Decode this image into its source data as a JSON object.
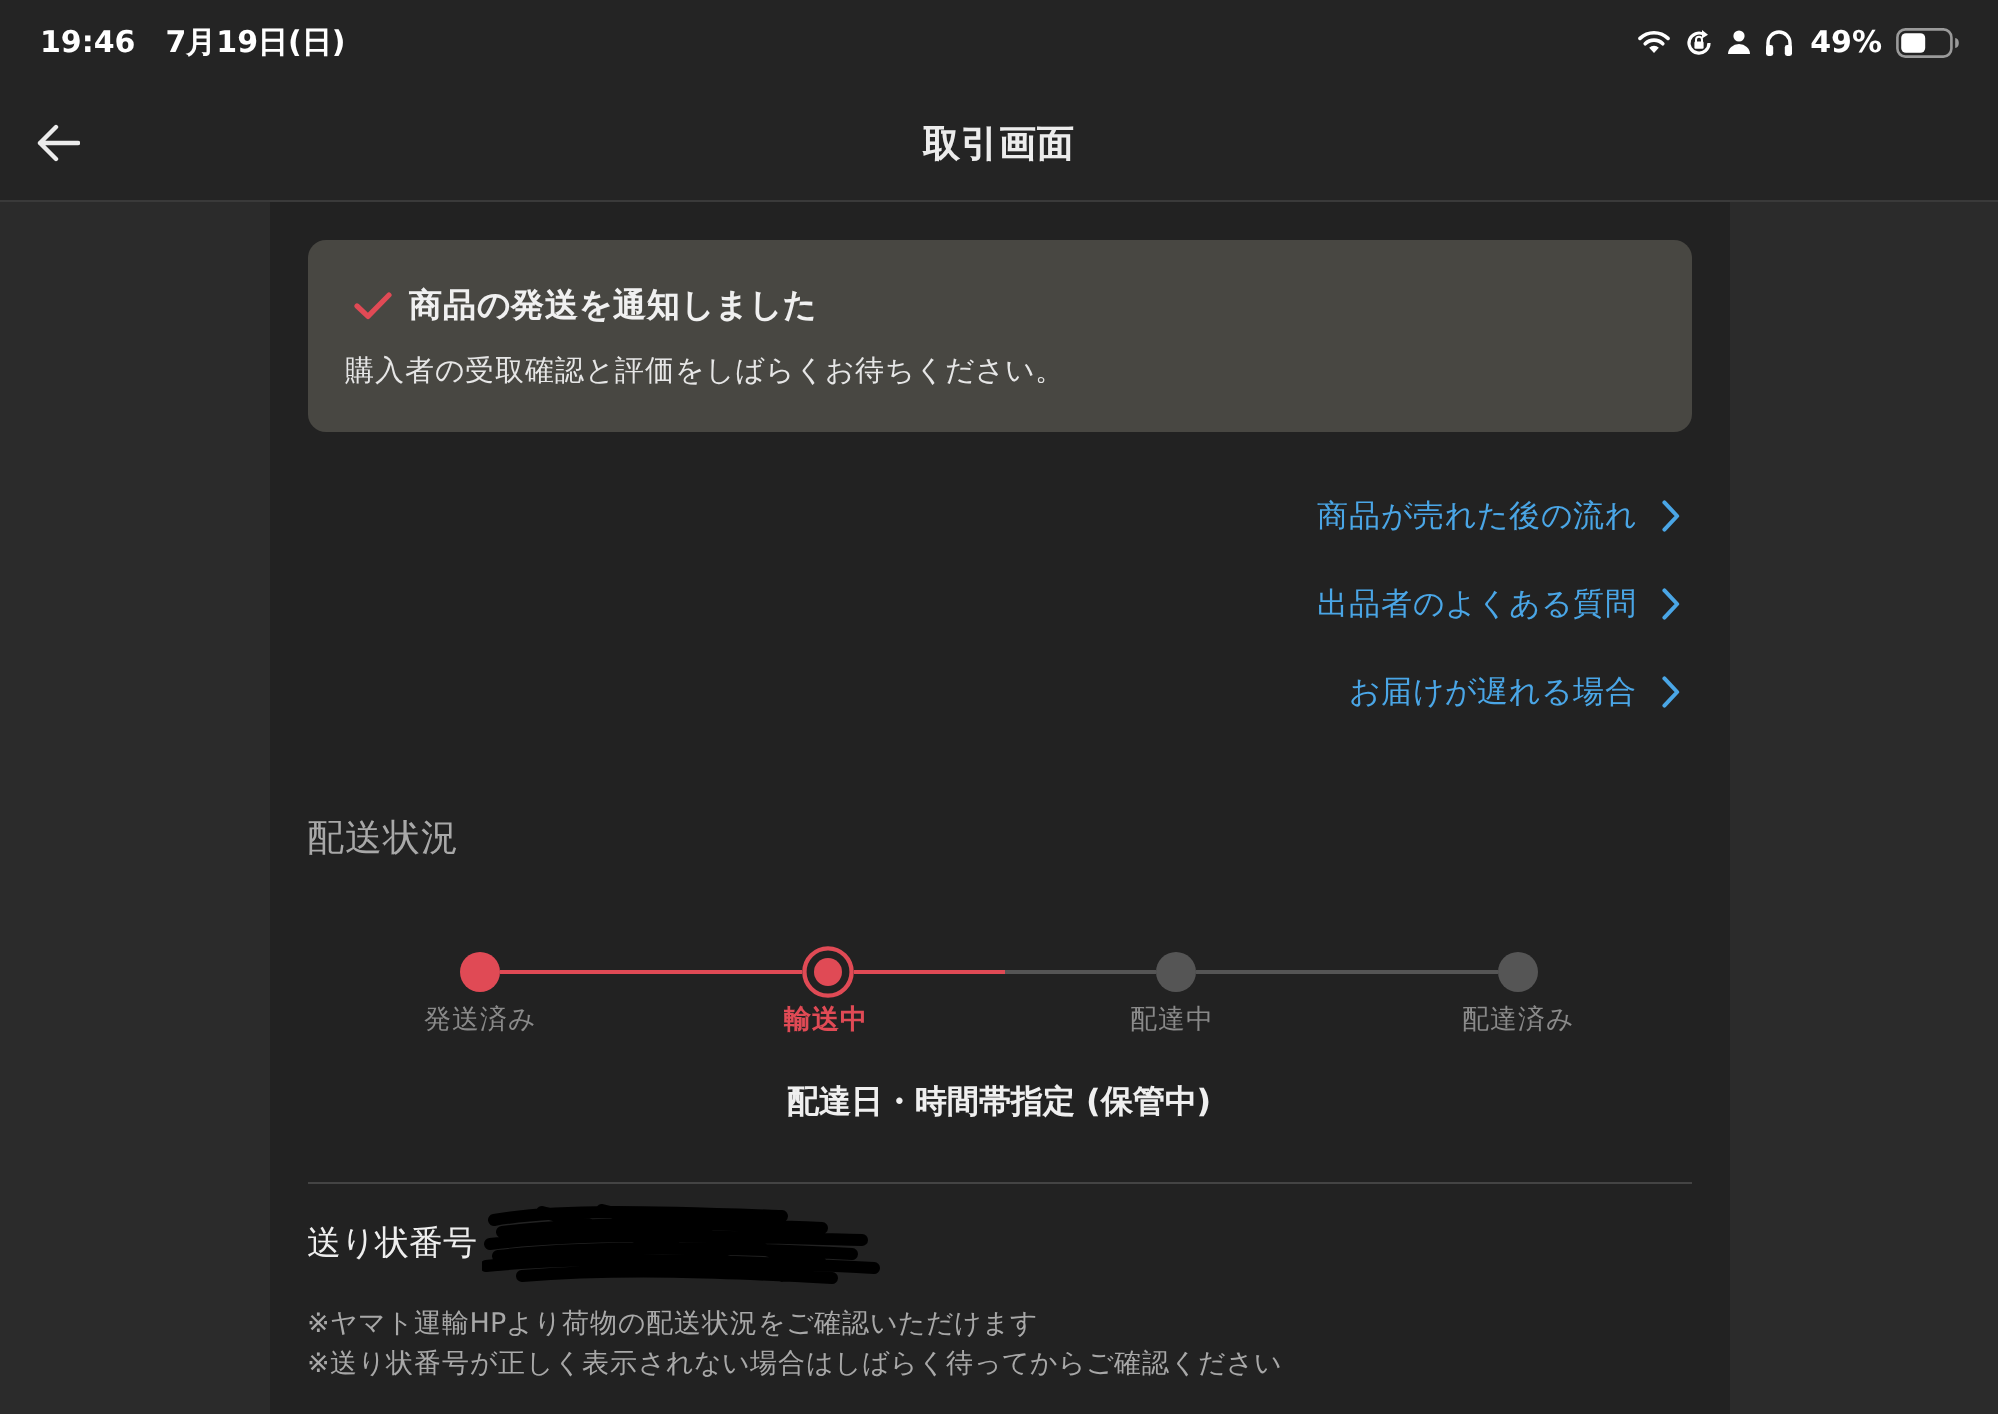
{
  "status_bar": {
    "time": "19:46",
    "date": "7月19日(日)",
    "battery_percent": "49%"
  },
  "header": {
    "title": "取引画面"
  },
  "notice": {
    "title": "商品の発送を通知しました",
    "message": "購入者の受取確認と評価をしばらくお待ちください。"
  },
  "links": [
    {
      "label": "商品が売れた後の流れ"
    },
    {
      "label": "出品者のよくある質問"
    },
    {
      "label": "お届けが遅れる場合"
    }
  ],
  "delivery_status": {
    "heading": "配送状況",
    "steps": [
      {
        "label": "発送済み",
        "completed": true,
        "selected": false
      },
      {
        "label": "輸送中",
        "completed": false,
        "selected": true
      },
      {
        "label": "配達中",
        "completed": false,
        "selected": false
      },
      {
        "label": "配達済み",
        "completed": false,
        "selected": false
      }
    ],
    "status_text": "配達日・時間帯指定 (保管中)"
  },
  "tracking": {
    "label": "送り状番号",
    "notes": [
      "※ヤマト運輸HPより荷物の配送状況をご確認いただけます",
      "※送り状番号が正しく表示されない場合はしばらく待ってからご確認ください"
    ]
  }
}
